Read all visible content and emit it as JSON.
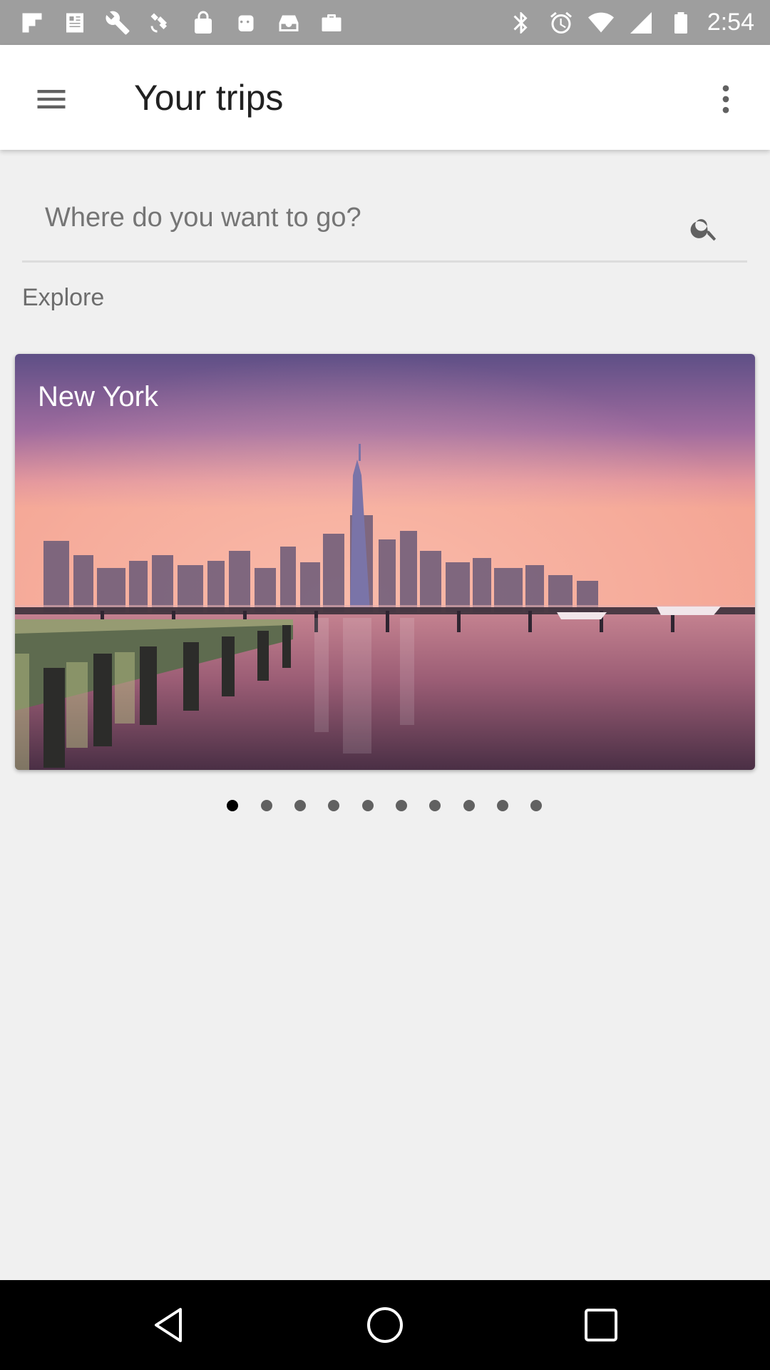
{
  "status_bar": {
    "time": "2:54",
    "icons": [
      "flipboard-icon",
      "news-icon",
      "wrench-icon",
      "satellite-icon",
      "lock-icon",
      "robot-icon",
      "inbox-check-icon",
      "briefcase-icon",
      "bluetooth-icon",
      "alarm-icon",
      "wifi-icon",
      "signal-icon",
      "battery-icon"
    ]
  },
  "app_bar": {
    "title": "Your trips",
    "menu_icon": "hamburger-menu-icon",
    "more_icon": "more-vertical-icon"
  },
  "search": {
    "placeholder": "Where do you want to go?",
    "icon": "search-icon"
  },
  "explore": {
    "label": "Explore",
    "card_title": "New York",
    "carousel_page_count": 10,
    "carousel_active_index": 0
  },
  "nav_bar": {
    "icons": [
      "back-icon",
      "home-icon",
      "recents-icon"
    ]
  }
}
